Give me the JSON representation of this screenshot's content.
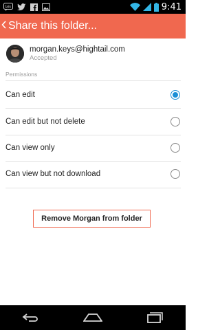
{
  "status_bar": {
    "time": "9:41",
    "notification_icons": [
      "talk-icon",
      "twitter-icon",
      "facebook-icon",
      "image-icon"
    ],
    "status_icons": [
      "wifi-icon",
      "signal-icon",
      "battery-icon"
    ]
  },
  "app_bar": {
    "title": "Share this folder...",
    "back_icon": "chevron-left-icon"
  },
  "user": {
    "email": "morgan.keys@hightail.com",
    "status": "Accepted"
  },
  "permissions": {
    "label": "Permissions",
    "selected": "Can edit",
    "options": [
      {
        "label": "Can edit",
        "checked": true
      },
      {
        "label": "Can edit but not delete",
        "checked": false
      },
      {
        "label": "Can view only",
        "checked": false
      },
      {
        "label": "Can view but not download",
        "checked": false
      }
    ]
  },
  "remove_button": {
    "label": "Remove Morgan from folder",
    "border_color": "#f0684f"
  },
  "colors": {
    "accent": "#f0684f",
    "radio_selected": "#1a8fd6"
  },
  "nav_bar": {
    "buttons": [
      "back-icon",
      "home-icon",
      "recent-apps-icon"
    ]
  }
}
